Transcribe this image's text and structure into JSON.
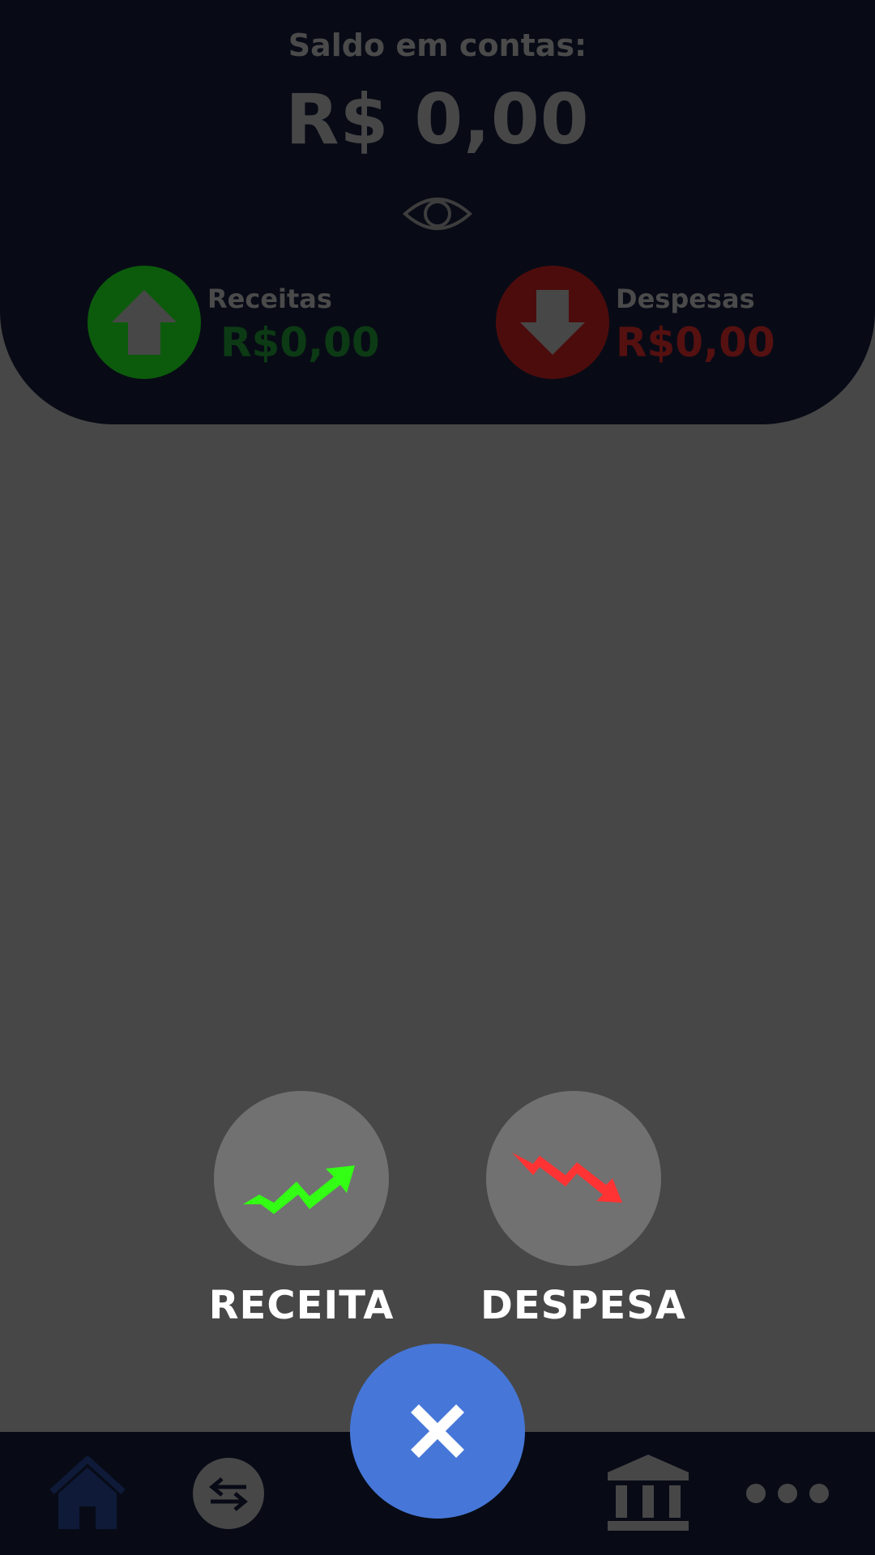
{
  "header": {
    "balance_label": "Saldo em contas:",
    "balance_value": "R$ 0,00",
    "visibility_icon": "eye-icon",
    "income": {
      "label": "Receitas",
      "value": "R$0,00",
      "icon": "arrow-up-icon",
      "color": "#0c5b0c"
    },
    "expense": {
      "label": "Despesas",
      "value": "R$0,00",
      "icon": "arrow-down-icon",
      "color": "#4d0c0c"
    }
  },
  "actions": {
    "receita": {
      "label": "RECEITA",
      "icon": "trend-up-icon",
      "color": "#33ff14"
    },
    "despesa": {
      "label": "DESPESA",
      "icon": "trend-down-icon",
      "color": "#ff3333"
    }
  },
  "fab": {
    "icon": "close-icon",
    "color": "#4677d8"
  },
  "bottom_nav": {
    "items": [
      {
        "name": "home",
        "icon": "home-icon"
      },
      {
        "name": "transactions",
        "icon": "transfer-icon"
      },
      {
        "name": "accounts",
        "icon": "bank-icon"
      },
      {
        "name": "more",
        "icon": "more-icon"
      }
    ]
  }
}
